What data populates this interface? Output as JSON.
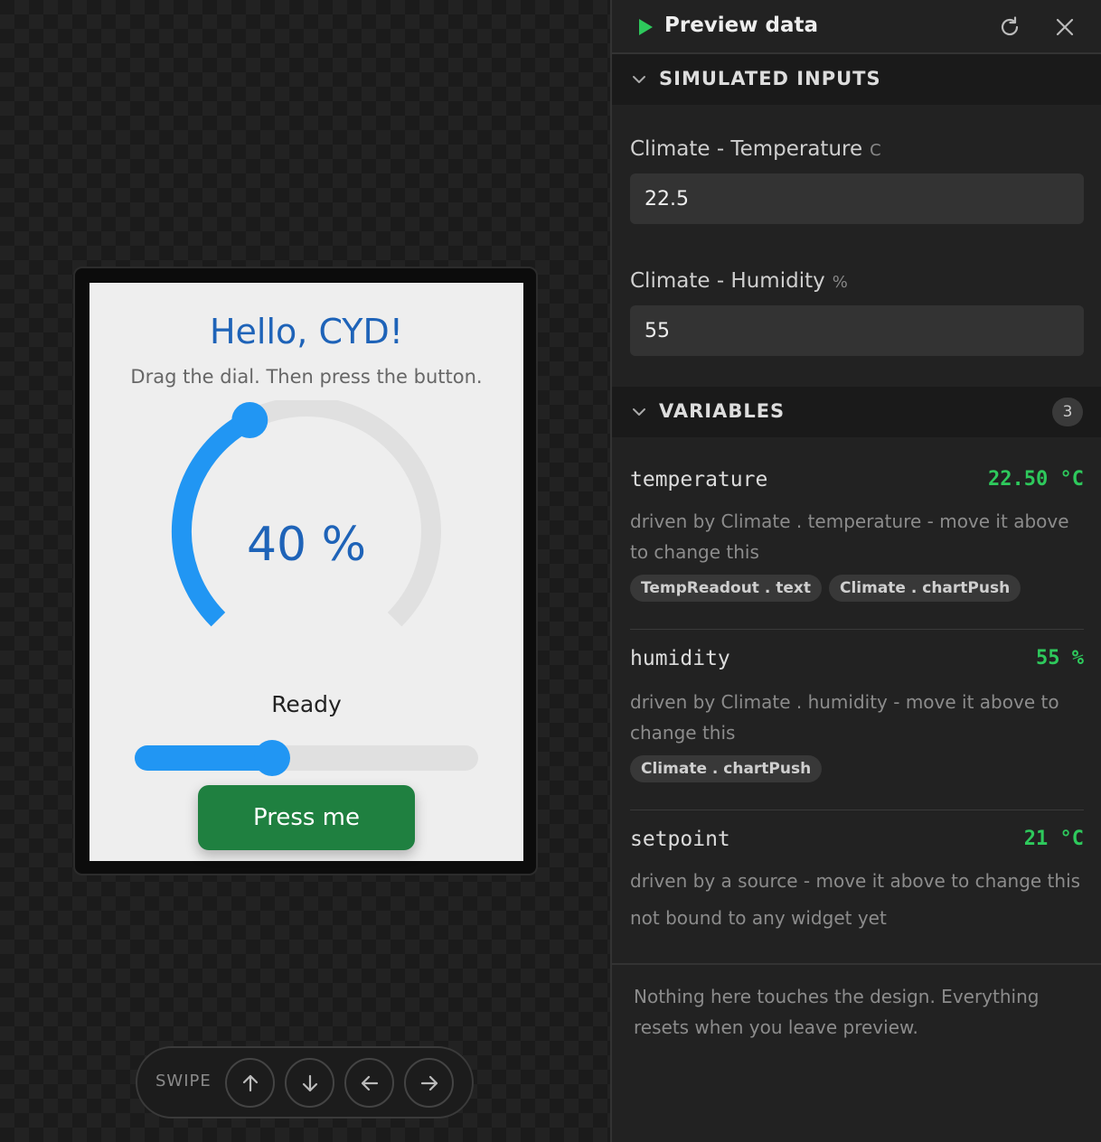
{
  "device": {
    "title": "Hello, CYD!",
    "subtitle": "Drag the dial. Then press the button.",
    "dial_text": "40 %",
    "dial_fraction": 0.4,
    "status": "Ready",
    "slider_fraction": 0.4,
    "button_label": "Press me",
    "colors": {
      "accent": "#2196f3",
      "title": "#1e63b8",
      "button": "#1f8040"
    }
  },
  "swipe": {
    "label": "SWIPE",
    "buttons": [
      "arrow-up-icon",
      "arrow-down-icon",
      "arrow-left-icon",
      "arrow-right-icon"
    ]
  },
  "panel": {
    "title": "Preview data",
    "icons": [
      "play-icon",
      "refresh-icon",
      "close-icon"
    ],
    "simulated_inputs": {
      "heading": "SIMULATED INPUTS",
      "fields": [
        {
          "label": "Climate - Temperature",
          "unit": "C",
          "value": "22.5"
        },
        {
          "label": "Climate - Humidity",
          "unit": "%",
          "value": "55"
        }
      ]
    },
    "variables": {
      "heading": "VARIABLES",
      "count": "3",
      "items": [
        {
          "name": "temperature",
          "value": "22.50 °C",
          "description": "driven by Climate . temperature - move it above to change this",
          "chips": [
            "TempReadout . text",
            "Climate . chartPush"
          ]
        },
        {
          "name": "humidity",
          "value": "55 %",
          "description": "driven by Climate . humidity - move it above to change this",
          "chips": [
            "Climate . chartPush"
          ]
        },
        {
          "name": "setpoint",
          "value": "21 °C",
          "description": "driven by a source - move it above to change this",
          "unbound": "not bound to any widget yet"
        }
      ]
    },
    "footer": "Nothing here touches the design. Everything resets when you leave preview.",
    "colors": {
      "value_green": "#2ec95c",
      "play_green": "#2ec95c"
    }
  }
}
